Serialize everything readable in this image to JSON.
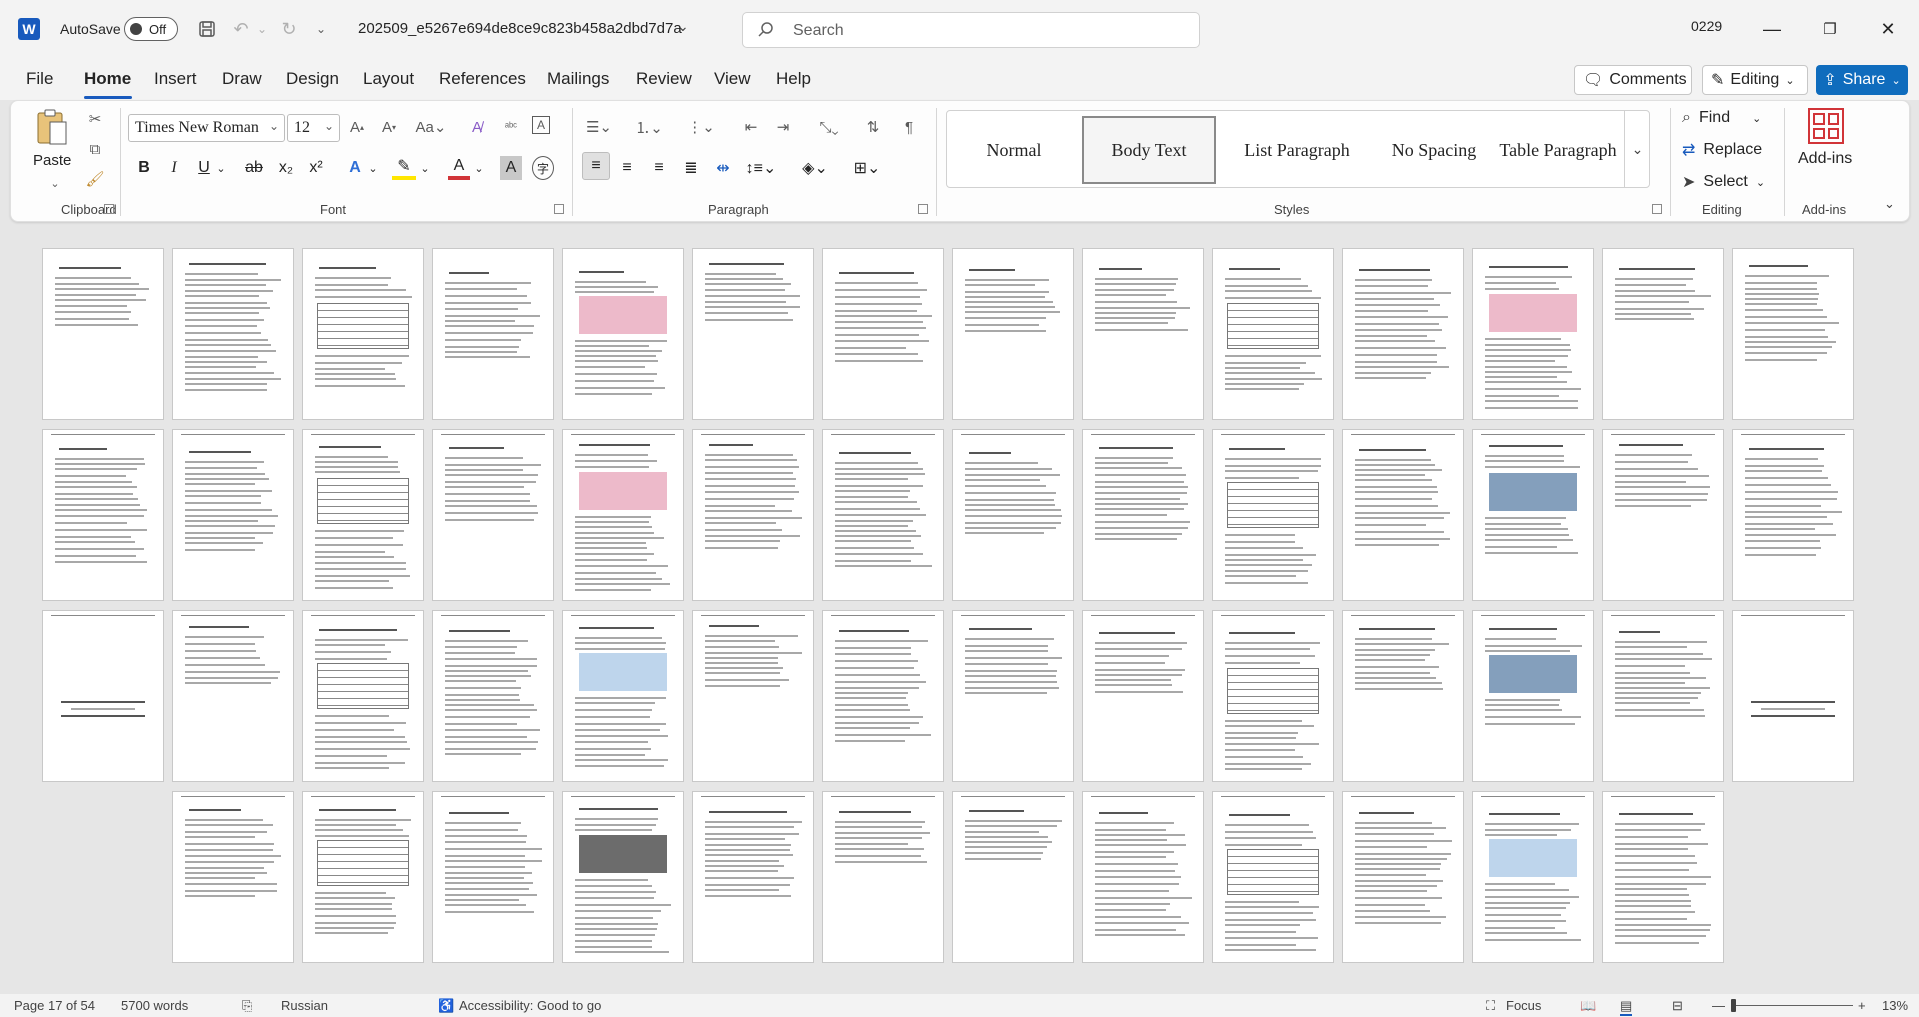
{
  "titlebar": {
    "app_logo_letter": "W",
    "autosave_label": "AutoSave",
    "autosave_state": "Off",
    "document_name": "202509_e5267e694de8ce9c823b458a2dbd7d7a",
    "search_placeholder": "Search",
    "user": "0229"
  },
  "menu": {
    "tabs": [
      "File",
      "Home",
      "Insert",
      "Draw",
      "Design",
      "Layout",
      "References",
      "Mailings",
      "Review",
      "View",
      "Help"
    ],
    "active_tab": "Home",
    "comments_label": "Comments",
    "editing_label": "Editing",
    "share_label": "Share"
  },
  "ribbon": {
    "clipboard": {
      "label": "Clipboard",
      "paste_label": "Paste"
    },
    "font": {
      "label": "Font",
      "font_name": "Times New Roman",
      "font_size": "12"
    },
    "paragraph": {
      "label": "Paragraph"
    },
    "styles": {
      "label": "Styles",
      "items": [
        "Normal",
        "Body Text",
        "List Paragraph",
        "No Spacing",
        "Table Paragraph"
      ],
      "selected": "Body Text"
    },
    "editing": {
      "label": "Editing",
      "find": "Find",
      "replace": "Replace",
      "select": "Select"
    },
    "addins": {
      "label": "Add-ins",
      "button": "Add-ins"
    }
  },
  "document": {
    "thumbnail_rows": 4,
    "thumbnails_per_row": 14,
    "total_pages": 54
  },
  "statusbar": {
    "page_info": "Page 17 of 54",
    "word_count": "5700 words",
    "language": "Russian",
    "accessibility": "Accessibility: Good to go",
    "focus": "Focus",
    "zoom": "13%"
  },
  "colors": {
    "accent": "#185abd",
    "share": "#0f6cbd",
    "addins": "#d13438"
  }
}
